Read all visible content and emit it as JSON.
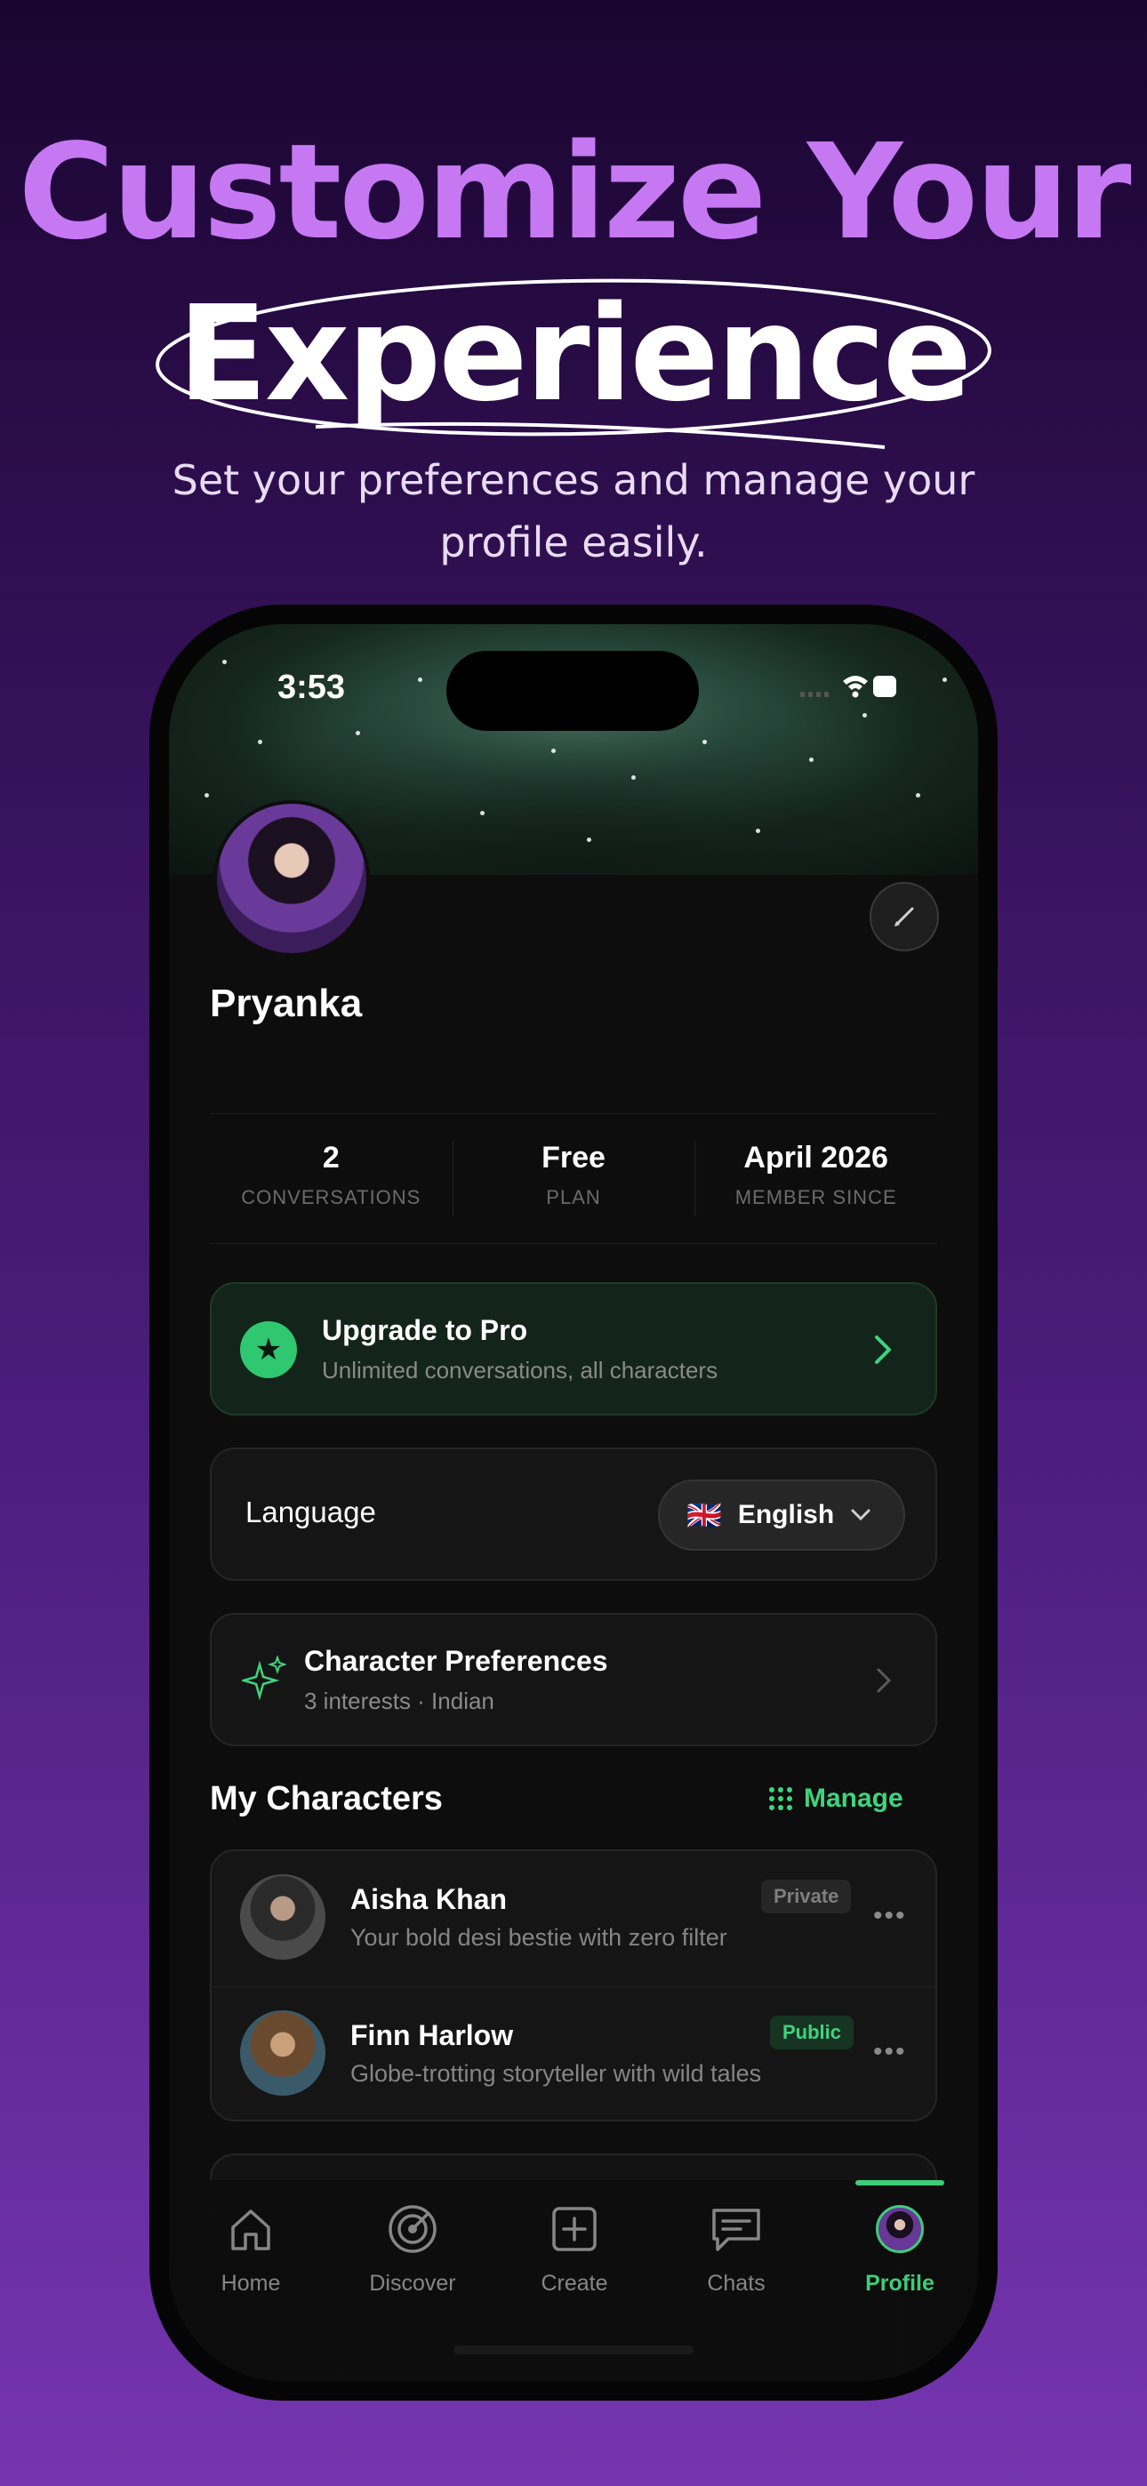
{
  "hero": {
    "title_line1": "Customize Your",
    "title_line2": "Experience",
    "subtitle_line1": "Set your preferences and manage your",
    "subtitle_line2": "profile easily."
  },
  "status_bar": {
    "time": "3:53"
  },
  "profile": {
    "name": "Pryanka",
    "stats": [
      {
        "value": "2",
        "label": "CONVERSATIONS"
      },
      {
        "value": "Free",
        "label": "PLAN"
      },
      {
        "value": "April 2026",
        "label": "MEMBER SINCE"
      }
    ]
  },
  "upgrade": {
    "title": "Upgrade to Pro",
    "subtitle": "Unlimited conversations, all characters"
  },
  "language": {
    "label": "Language",
    "flag": "🇬🇧",
    "value": "English"
  },
  "preferences": {
    "title": "Character Preferences",
    "subtitle": "3 interests · Indian"
  },
  "my_characters": {
    "title": "My Characters",
    "manage_label": "Manage",
    "items": [
      {
        "name": "Aisha Khan",
        "description": "Your bold desi bestie with zero filter",
        "badge": "Private"
      },
      {
        "name": "Finn Harlow",
        "description": "Globe-trotting storyteller with wild tales",
        "badge": "Public"
      }
    ]
  },
  "tabs": [
    {
      "label": "Home",
      "icon": "home-icon"
    },
    {
      "label": "Discover",
      "icon": "radar-icon"
    },
    {
      "label": "Create",
      "icon": "plus-square-icon"
    },
    {
      "label": "Chats",
      "icon": "chat-icon"
    },
    {
      "label": "Profile",
      "icon": "avatar-icon",
      "active": true
    }
  ],
  "colors": {
    "accent_green": "#3fd37e",
    "hero_purple": "#c678f2",
    "background": "#0d0d0d"
  }
}
